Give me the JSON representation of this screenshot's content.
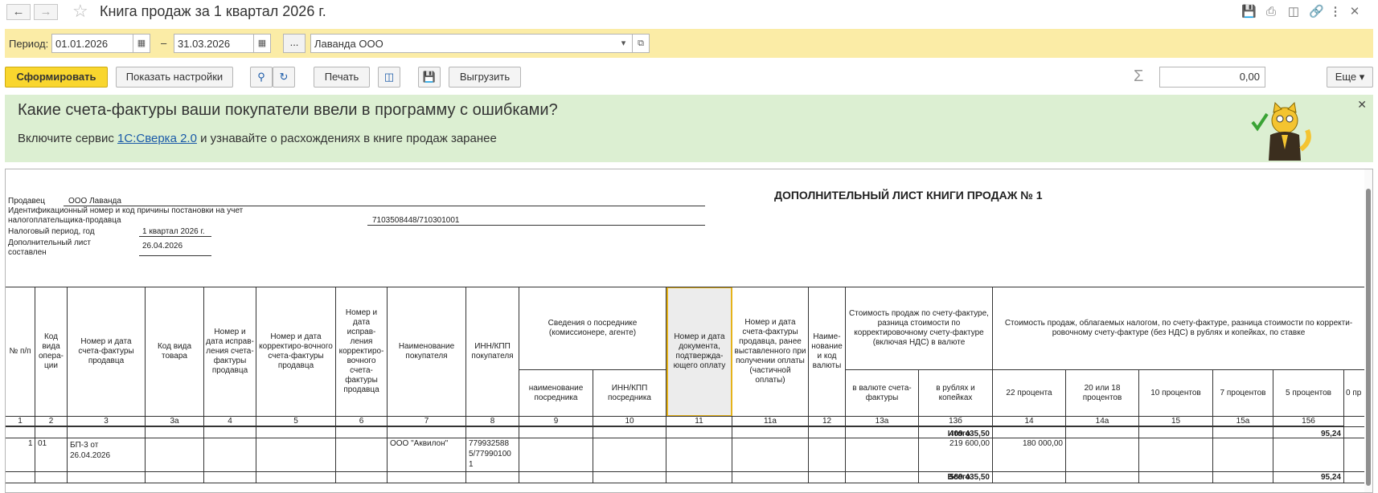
{
  "window": {
    "title": "Книга продаж за 1 квартал 2026 г."
  },
  "period": {
    "label": "Период:",
    "from": "01.01.2026",
    "to": "31.03.2026",
    "dash": "–",
    "dots": "...",
    "organization": "Лаванда ООО"
  },
  "toolbar": {
    "generate": "Сформировать",
    "show_settings": "Показать настройки",
    "print": "Печать",
    "export": "Выгрузить",
    "sum_value": "0,00",
    "more": "Еще"
  },
  "banner": {
    "title": "Какие счета-фактуры ваши покупатели ввели в программу с ошибками?",
    "text_before": "Включите сервис ",
    "link": "1С:Сверка 2.0",
    "text_after": " и узнавайте о расхождениях в книге продаж заранее"
  },
  "report": {
    "title": "ДОПОЛНИТЕЛЬНЫЙ ЛИСТ КНИГИ ПРОДАЖ № 1",
    "seller_label": "Продавец",
    "seller_value": "ООО Лаванда",
    "inn_label_1": "Идентификационный номер и код причины постановки на учет",
    "inn_label_2": "налогоплательщика-продавца",
    "inn_value": "7103508448/710301001",
    "period_label": "Налоговый период, год",
    "period_value": "1 квартал 2026 г.",
    "sheet_label_1": "Дополнительный лист",
    "sheet_label_2": "составлен",
    "sheet_value": "26.04.2026",
    "columns": {
      "c1": "№ п/п",
      "c2": "Код вида опера-ции",
      "c3": "Номер и дата счета-фактуры продавца",
      "c3a": "Код вида товара",
      "c4": "Номер и дата исправ-ления счета-фактуры продавца",
      "c5": "Номер и дата корректиро-вочного счета-фактуры продавца",
      "c6": "Номер и дата исправ-ления корректиро-вочного счета-фактуры продавца",
      "c7": "Наименование покупателя",
      "c8": "ИНН/КПП покупателя",
      "c_agent": "Сведения о посреднике (комиссионере, агенте)",
      "c9": "наименование посредника",
      "c10": "ИНН/КПП посредника",
      "c11": "Номер и дата документа, подтвержда-ющего оплату",
      "c11a": "Номер и дата счета-фактуры продавца, ранее выставленного при получении оплаты (частичной оплаты)",
      "c12": "Наиме-нование и код валюты",
      "c_cost": "Стоимость продаж по счету-фактуре, разница стоимости по корректировочному счету-фактуре (включая НДС) в валюте",
      "c13a": "в валюте счета-фактуры",
      "c13b": "в рублях и копейках",
      "c_taxable": "Стоимость продаж, облагаемых налогом, по счету-фактуре, разница стоимости по корректи-ровочному счету-фактуре (без НДС) в рублях и копейках, по ставке",
      "c14": "22 процента",
      "c14a": "20 или 18 процентов",
      "c15": "10 процентов",
      "c15a": "7 процентов",
      "c156": "5 процентов",
      "c_zero": "0 пр"
    },
    "numbers": [
      "1",
      "2",
      "3",
      "3а",
      "4",
      "5",
      "6",
      "7",
      "8",
      "9",
      "10",
      "11",
      "11а",
      "12",
      "13а",
      "13б",
      "14",
      "14а",
      "15",
      "15а",
      "156"
    ],
    "itogo_label": "Итого",
    "itogo_13b": "409 435,50",
    "itogo_156": "95,24",
    "row": {
      "n": "1",
      "op": "01",
      "invoice_1": "БП-3 от",
      "invoice_2": "26.04.2026",
      "buyer": "ООО \"Аквилон\"",
      "inn_1": "779932588",
      "inn_2": "5/77990100",
      "inn_3": "1",
      "rub": "219 600,00",
      "p22": "180 000,00"
    },
    "vsego_label": "Всего",
    "vsego_13b": "589 435,50",
    "vsego_156": "95,24"
  }
}
